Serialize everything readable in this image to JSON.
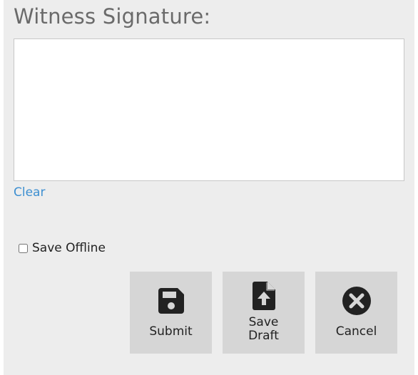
{
  "form": {
    "title": "Witness Signature:",
    "clear_label": "Clear",
    "offline_label": "Save Offline",
    "offline_checked": false
  },
  "actions": {
    "submit_label": "Submit",
    "draft_label_line1": "Save",
    "draft_label_line2": "Draft",
    "cancel_label": "Cancel",
    "icons": {
      "submit": "floppy-disk-icon",
      "draft": "file-upload-icon",
      "cancel": "close-circle-icon"
    }
  },
  "colors": {
    "panel_bg": "#ededed",
    "button_bg": "#d6d6d6",
    "link": "#3d8fd1",
    "title": "#6a6a6a",
    "icon": "#222222"
  }
}
